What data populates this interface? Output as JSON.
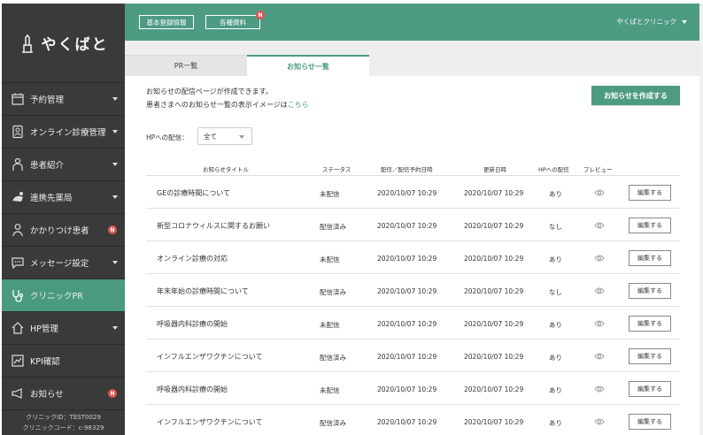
{
  "logo": {
    "text": "やくばと"
  },
  "sidebar": {
    "items": [
      {
        "label": "予約管理",
        "icon": "calendar-icon",
        "caret": true
      },
      {
        "label": "オンライン診療管理",
        "icon": "tablet-doctor-icon",
        "caret": true
      },
      {
        "label": "患者紹介",
        "icon": "patient-icon",
        "caret": true
      },
      {
        "label": "連携先薬局",
        "icon": "pharmacy-icon",
        "caret": true
      },
      {
        "label": "かかりつけ患者",
        "icon": "person-icon",
        "badge": "N"
      },
      {
        "label": "メッセージ設定",
        "icon": "chat-bubble-icon",
        "caret": true
      },
      {
        "label": "クリニックPR",
        "icon": "stethoscope-icon",
        "active": true
      },
      {
        "label": "HP管理",
        "icon": "home-icon",
        "caret": true
      },
      {
        "label": "KPI確認",
        "icon": "chart-icon"
      },
      {
        "label": "お知らせ",
        "icon": "megaphone-icon",
        "badge": "N"
      }
    ],
    "clinic_id": "クリニックID：TEST0029",
    "clinic_code": "クリニックコード：c-98329"
  },
  "header": {
    "btn_basic": "基本登録情報",
    "btn_docs": "各種資料",
    "docs_badge": "N",
    "clinic_name": "やくばとクリニック"
  },
  "tabs": {
    "pr": "PR一覧",
    "news": "お知らせ一覧"
  },
  "main": {
    "intro1": "お知らせの配信ページが作成できます。",
    "intro2_prefix": "患者さまへのお知らせ一覧の表示イメージは",
    "intro2_link": "こちら",
    "create_button": "お知らせを作成する",
    "filter_label": "HPへの配信：",
    "filter_value": "全て"
  },
  "table": {
    "headers": {
      "title": "お知らせタイトル",
      "status": "ステータス",
      "publish": "配信／配信予約日時",
      "updated": "更新日時",
      "hp": "HPへの配信",
      "preview": "プレビュー"
    },
    "edit_label": "編集する",
    "rows": [
      {
        "title": "GEの診療時間について",
        "status": "未配信",
        "publish": "2020/10/07 10:29",
        "updated": "2020/10/07 10:29",
        "hp": "あり"
      },
      {
        "title": "新型コロナウィルスに関するお願い",
        "status": "配信済み",
        "publish": "2020/10/07 10:29",
        "updated": "2020/10/07 10:29",
        "hp": "なし"
      },
      {
        "title": "オンライン診療の対応",
        "status": "未配信",
        "publish": "2020/10/07 10:29",
        "updated": "2020/10/07 10:29",
        "hp": "あり"
      },
      {
        "title": "年末年始の診療時間について",
        "status": "配信済み",
        "publish": "2020/10/07 10:29",
        "updated": "2020/10/07 10:29",
        "hp": "なし"
      },
      {
        "title": "呼吸器内科診療の開始",
        "status": "未配信",
        "publish": "2020/10/07 10:29",
        "updated": "2020/10/07 10:29",
        "hp": "あり"
      },
      {
        "title": "インフルエンザワクチンについて",
        "status": "配信済み",
        "publish": "2020/10/07 10:29",
        "updated": "2020/10/07 10:29",
        "hp": "あり"
      },
      {
        "title": "呼吸器内科診療の開始",
        "status": "未配信",
        "publish": "2020/10/07 10:29",
        "updated": "2020/10/07 10:29",
        "hp": "あり"
      },
      {
        "title": "インフルエンザワクチンについて",
        "status": "配信済み",
        "publish": "2020/10/07 10:29",
        "updated": "2020/10/07 10:29",
        "hp": "あり"
      }
    ]
  },
  "colors": {
    "accent": "#4e9b84",
    "sidebar_bg": "#3a3a3a",
    "badge": "#e05454"
  }
}
